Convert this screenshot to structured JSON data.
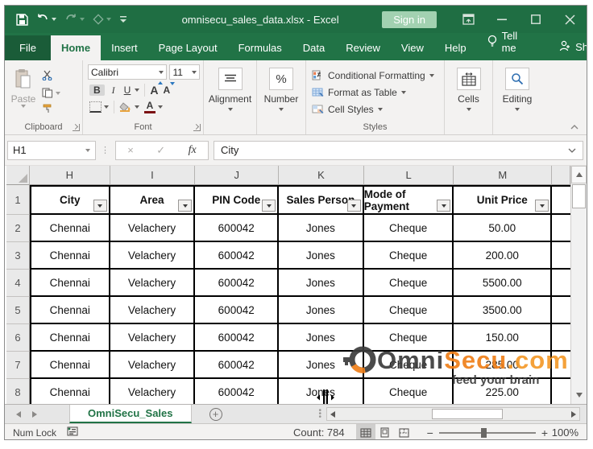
{
  "titlebar": {
    "title": "omnisecu_sales_data.xlsx - Excel",
    "sign_in_label": "Sign in"
  },
  "ribbon": {
    "tabs": [
      "File",
      "Home",
      "Insert",
      "Page Layout",
      "Formulas",
      "Data",
      "Review",
      "View",
      "Help"
    ],
    "active_tab": "Home",
    "tell_me_label": "Tell me",
    "share_label": "Share",
    "clipboard": {
      "group_label": "Clipboard",
      "paste_label": "Paste"
    },
    "font": {
      "group_label": "Font",
      "font_name": "Calibri",
      "font_size": "11",
      "bold": "B",
      "italic": "I",
      "underline": "U",
      "grow": "A",
      "shrink": "A",
      "color_letter": "A"
    },
    "alignment": {
      "label": "Alignment"
    },
    "number": {
      "label": "Number",
      "percent": "%"
    },
    "styles": {
      "group_label": "Styles",
      "items": [
        "Conditional Formatting",
        "Format as Table",
        "Cell Styles"
      ]
    },
    "cells": {
      "label": "Cells"
    },
    "editing": {
      "label": "Editing"
    }
  },
  "formula_bar": {
    "name_box": "H1",
    "cancel": "×",
    "enter": "✓",
    "fx": "fx",
    "value": "City"
  },
  "grid": {
    "column_letters": [
      "H",
      "I",
      "J",
      "K",
      "L",
      "M"
    ],
    "header_cells": [
      "City",
      "Area",
      "PIN Code",
      "Sales Person",
      "Mode of Payment",
      "Unit Price"
    ],
    "row_numbers": [
      "1",
      "2",
      "3",
      "4",
      "5",
      "6",
      "7",
      "8"
    ],
    "rows": [
      [
        "Chennai",
        "Velachery",
        "600042",
        "Jones",
        "Cheque",
        "50.00"
      ],
      [
        "Chennai",
        "Velachery",
        "600042",
        "Jones",
        "Cheque",
        "200.00"
      ],
      [
        "Chennai",
        "Velachery",
        "600042",
        "Jones",
        "Cheque",
        "5500.00"
      ],
      [
        "Chennai",
        "Velachery",
        "600042",
        "Jones",
        "Cheque",
        "3500.00"
      ],
      [
        "Chennai",
        "Velachery",
        "600042",
        "Jones",
        "Cheque",
        "150.00"
      ],
      [
        "Chennai",
        "Velachery",
        "600042",
        "Jones",
        "Cheque",
        "285.00"
      ],
      [
        "Chennai",
        "Velachery",
        "600042",
        "Jones",
        "Cheque",
        "225.00"
      ]
    ]
  },
  "watermark": {
    "brand_dark": "Omni",
    "brand_orange": "Secu",
    "brand_suffix": ".com",
    "tagline": "feed your brain",
    "color_dark": "#3c3c3c",
    "color_orange": "#ef7f1a"
  },
  "sheet_bar": {
    "active_tab": "OmniSecu_Sales",
    "add_sheet": "+"
  },
  "status_bar": {
    "num_lock": "Num Lock",
    "count": "Count: 784",
    "zoom_level": "100%",
    "zoom_minus": "−",
    "zoom_plus": "+"
  },
  "colors": {
    "excel_green": "#217346",
    "title_green": "#1f6e43",
    "fill_orange": "#e8a33d",
    "font_red": "#7b1113"
  }
}
